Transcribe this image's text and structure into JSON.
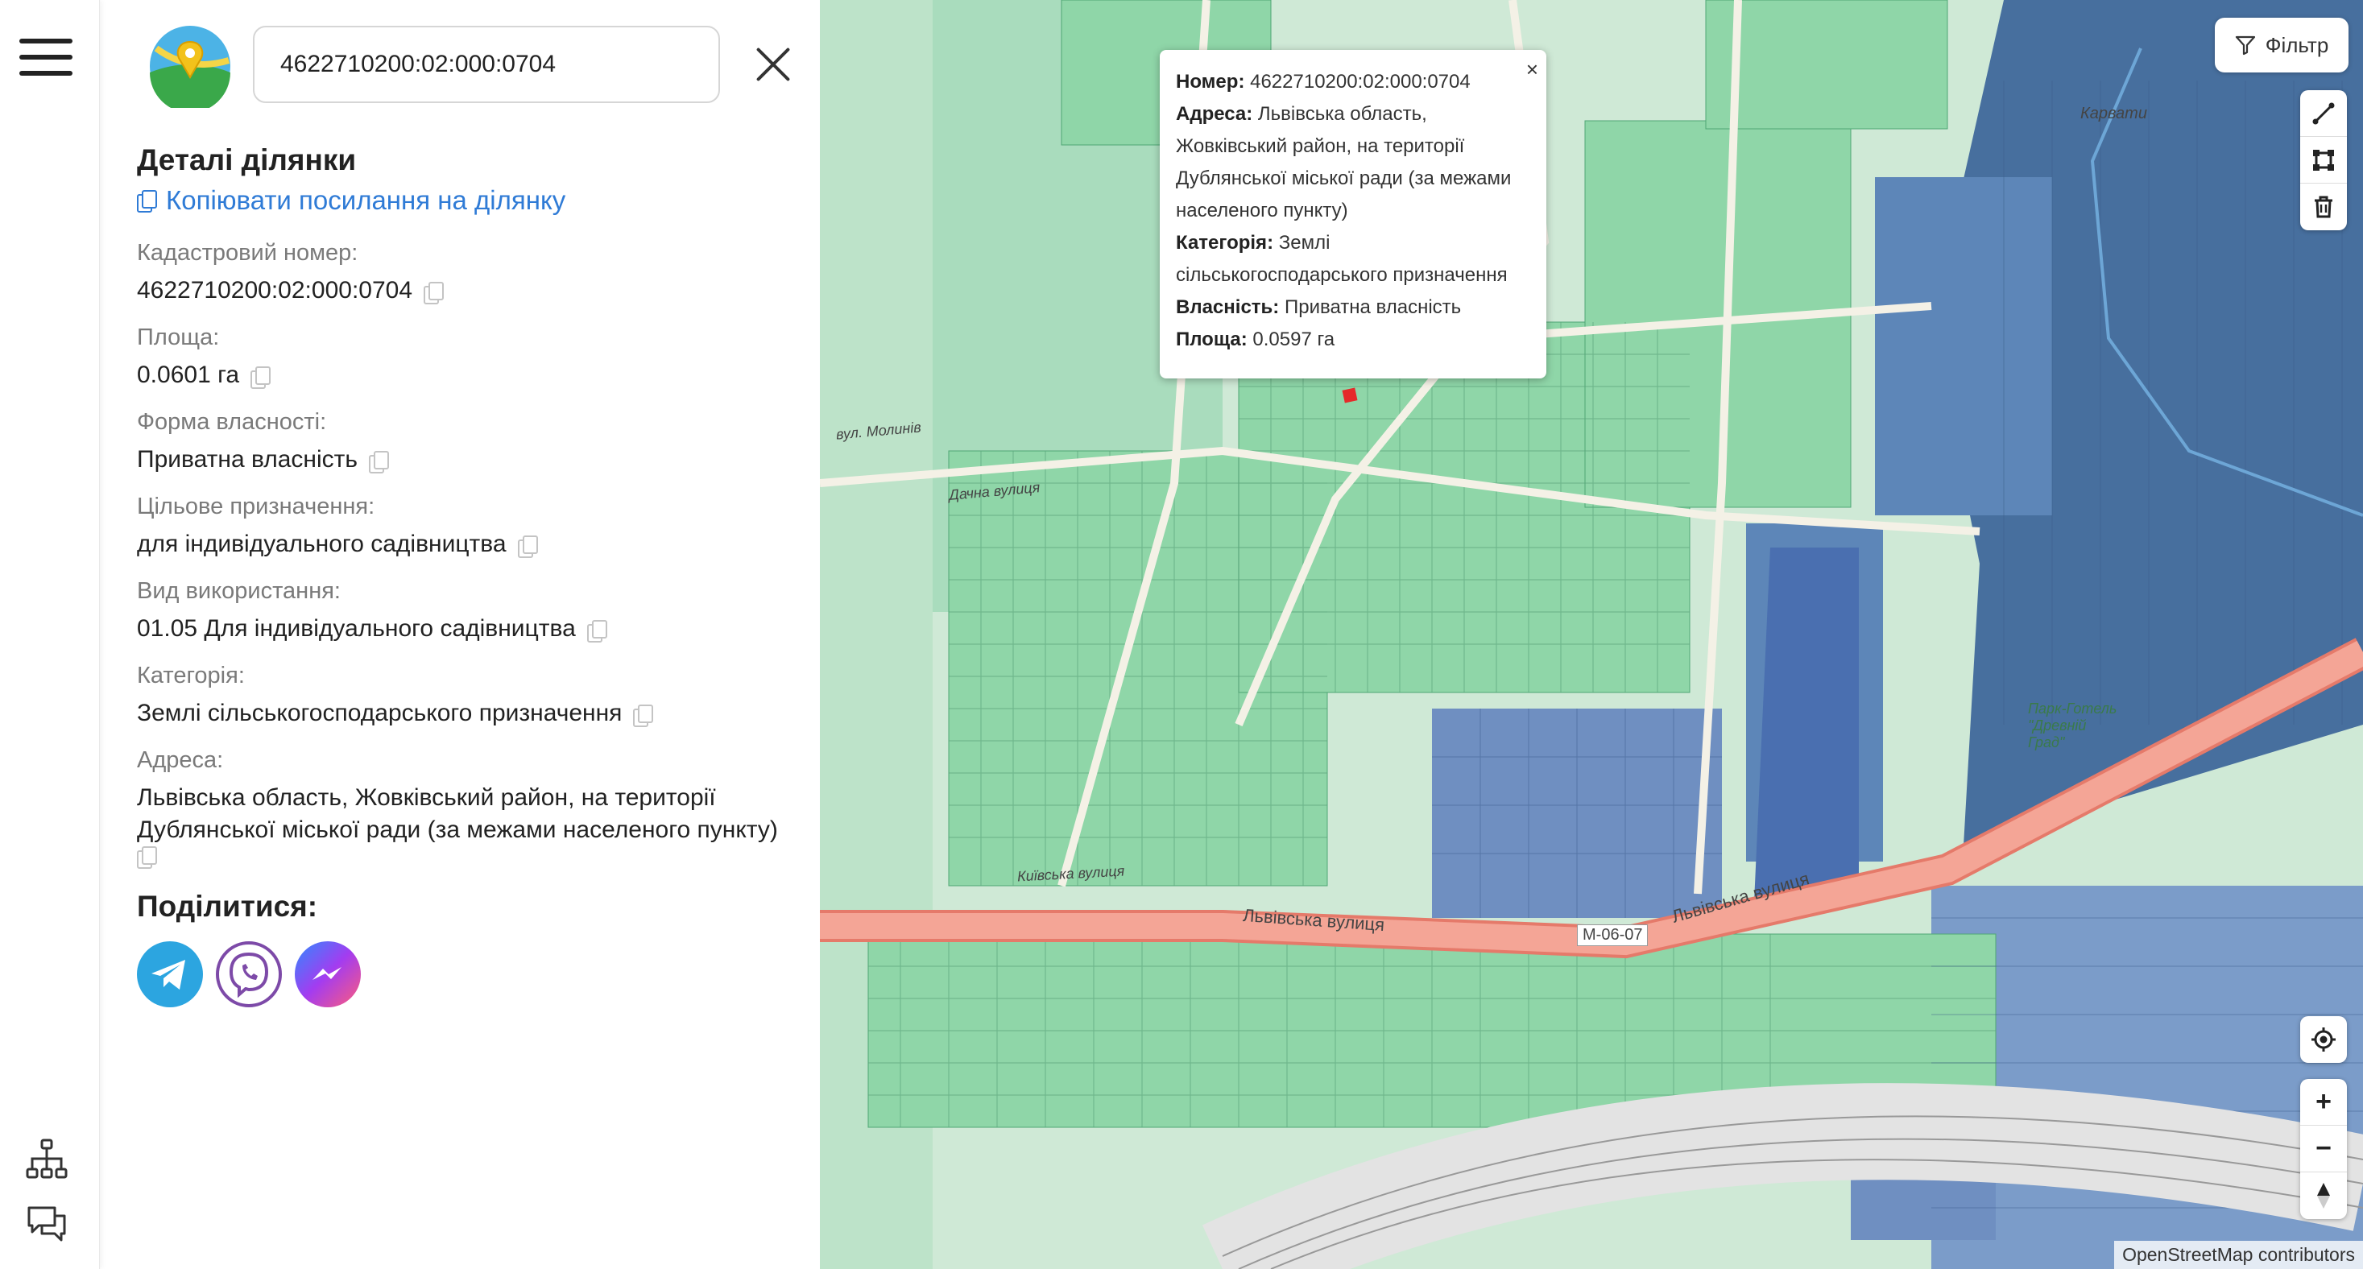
{
  "search": {
    "value": "4622710200:02:000:0704"
  },
  "details": {
    "title": "Деталі ділянки",
    "copy_link": "Копіювати посилання на ділянку",
    "fields": [
      {
        "label": "Кадастровий номер:",
        "value": "4622710200:02:000:0704"
      },
      {
        "label": "Площа:",
        "value": "0.0601 га"
      },
      {
        "label": "Форма власності:",
        "value": "Приватна власність"
      },
      {
        "label": "Цільове призначення:",
        "value": "для індивідуального садівництва"
      },
      {
        "label": "Вид використання:",
        "value": "01.05 Для індивідуального садівництва"
      },
      {
        "label": "Категорія:",
        "value": "Землі сільськогосподарського призначення"
      },
      {
        "label": "Адреса:",
        "value": "Львівська область, Жовківський район, на території Дублянської міської ради (за межами населеного пункту)"
      }
    ],
    "share_title": "Поділитися:",
    "share_buttons": [
      "telegram-icon",
      "viber-icon",
      "messenger-icon"
    ]
  },
  "popup": {
    "number_label": "Номер:",
    "number_value": "4622710200:02:000:0704",
    "address_label": "Адреса:",
    "address_value": "Львівська область, Жовківський район, на території Дублянської міської ради (за межами населеного пункту)",
    "category_label": "Категорія:",
    "category_value": "Землі сільськогосподарського призначення",
    "ownership_label": "Власність:",
    "ownership_value": "Приватна власність",
    "area_label": "Площа:",
    "area_value": "0.0597 га",
    "close": "×"
  },
  "map": {
    "filter_label": "Фільтр",
    "attribution": "OpenStreetMap contributors",
    "labels": {
      "karvaty": "Карвати",
      "street_lvivska_1": "Львівська вулиця",
      "street_lvivska_2": "Львівська вулиця",
      "road_badge": "М-06-07",
      "park": "Парк-Готель \"Древній Град\"",
      "street_molyniv": "вул. Молинів",
      "street_dachna": "Дачна вулиця",
      "street_kyivska": "Київська вулиця"
    },
    "zoom_in": "+",
    "zoom_out": "−"
  },
  "colors": {
    "parcel_green": "#7fcf9e",
    "parcel_blue": "#6f8fc1",
    "selected_parcel": "#e52a2a",
    "road_main": "#f29c8e",
    "link_blue": "#2f7bd6"
  }
}
